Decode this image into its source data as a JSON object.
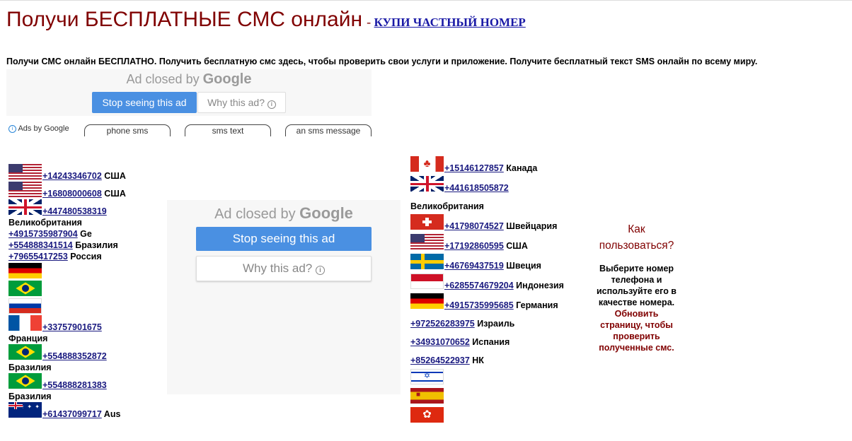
{
  "header": {
    "title": "Получи БЕСПЛАТНЫЕ СМС онлайн",
    "separator": "-",
    "buy_link": "КУПИ ЧАСТНЫЙ НОМЕР"
  },
  "description": "Получи СМС онлайн БЕСПЛАТНО. Получить бесплатную смс здесь, чтобы проверить свои услуги и приложение. Получите бесплатный текст SMS онлайн по всему миру.",
  "ads": {
    "closed_text": "Ad closed by",
    "google": "Google",
    "stop_label": "Stop seeing this ad",
    "why_label": "Why this ad?",
    "info_glyph": "i",
    "ads_by": "Ads by Google",
    "pills": [
      "phone sms",
      "sms text",
      "an sms message"
    ]
  },
  "left_numbers": [
    {
      "flag": "us",
      "number": "+14243346702",
      "country": "США"
    },
    {
      "flag": "us",
      "number": "+16808000608",
      "country": "США"
    },
    {
      "flag": "uk",
      "number": "+447480538319",
      "country": "Великобритания"
    },
    {
      "number": "+4915735987904",
      "country": "Ge"
    },
    {
      "number": "+554888341514",
      "country": "Бразилия"
    },
    {
      "number": "+79655417253",
      "country": "Россия"
    },
    {
      "flag": "de"
    },
    {
      "flag": "br"
    },
    {
      "flag": "ru"
    },
    {
      "flag": "fr",
      "number": "+33757901675",
      "country": "Франция"
    },
    {
      "flag": "br",
      "number": "+554888352872",
      "country": "Бразилия"
    },
    {
      "flag": "br",
      "number": "+554888281383",
      "country": "Бразилия"
    },
    {
      "flag": "au",
      "number": "+61437099717",
      "country": "Aus"
    }
  ],
  "right_numbers": [
    {
      "flag": "ca",
      "number": "+15146127857",
      "country": "Канада"
    },
    {
      "flag": "uk",
      "number": "+441618505872",
      "country": "Великобритания"
    },
    {
      "flag": "ch",
      "number": "+41798074527",
      "country": "Швейцария"
    },
    {
      "flag": "us",
      "number": "+17192860595",
      "country": "США"
    },
    {
      "flag": "se",
      "number": "+46769437519",
      "country": "Швеция"
    },
    {
      "flag": "id",
      "number": "+6285574679204",
      "country": "Индонезия"
    },
    {
      "flag": "de",
      "number": "+4915735995685",
      "country": "Германия"
    },
    {
      "number": "+972526283975",
      "country": "Израиль"
    },
    {
      "number": "+34931070652",
      "country": "Испания"
    },
    {
      "number": "+85264522937",
      "country": "НК"
    },
    {
      "flag": "il"
    },
    {
      "flag": "es"
    },
    {
      "flag": "hk"
    }
  ],
  "help": {
    "question": "Как пользоваться?",
    "instruction": "Выберите номер телефона и используйте его в качестве номера.",
    "refresh": "Обновить страницу, чтобы проверить полученные смс."
  }
}
